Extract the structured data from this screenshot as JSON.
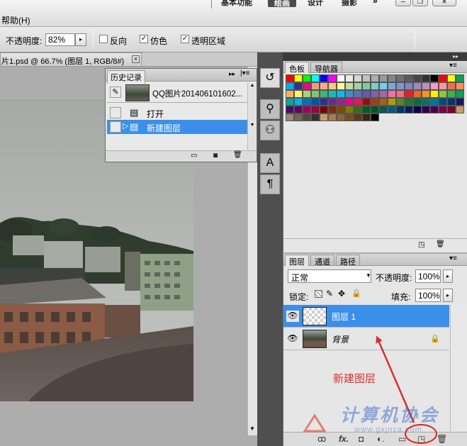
{
  "menubar": {
    "help": "帮助(H)",
    "workspaces": [
      "基本功能",
      "绘画",
      "设计",
      "摄影"
    ],
    "more": "»",
    "window_controls": [
      "minimize-icon",
      "restore-icon",
      "close-icon"
    ]
  },
  "options": {
    "opacity_label": "不透明度:",
    "opacity_value": "82%",
    "reverse": {
      "label": "反向",
      "checked": false
    },
    "dither": {
      "label": "仿色",
      "checked": true
    },
    "transparency": {
      "label": "透明区域",
      "checked": true
    }
  },
  "document": {
    "tab_title": "片1.psd @ 66.7% (图层 1, RGB/8#)",
    "close": "×"
  },
  "history": {
    "title": "历史记录",
    "snapshot": "QQ图片201406101602...",
    "steps": [
      {
        "label": "打开",
        "active": false
      },
      {
        "label": "新建图层",
        "active": true
      }
    ]
  },
  "swatches": {
    "tabs": [
      "色板",
      "导航器"
    ],
    "colors": [
      [
        "#ff0000",
        "#ffff00",
        "#00ff00",
        "#00ffff",
        "#0000ff",
        "#ff00ff",
        "#ffffff",
        "#ebebeb",
        "#d6d6d6",
        "#c2c2c2",
        "#adadad",
        "#999999",
        "#858585",
        "#707070",
        "#5c5c5c",
        "#474747",
        "#333333",
        "#000000",
        "#ff0000",
        "#ffff00",
        "#00a651"
      ],
      [
        "#00aeef",
        "#2e3192",
        "#ec008c",
        "#f7977a",
        "#f9ad81",
        "#fdc68a",
        "#fff79a",
        "#c4df9b",
        "#a3d39c",
        "#82ca9d",
        "#7bcdc8",
        "#6ecff6",
        "#7ea7d8",
        "#8493ca",
        "#8882be",
        "#a187be",
        "#bc8dbf",
        "#f49ac2",
        "#f6989d",
        "#f26c4f",
        "#f68e55"
      ],
      [
        "#fbaf5c",
        "#fff467",
        "#acd372",
        "#7cc576",
        "#3bb878",
        "#1abbb4",
        "#00bff3",
        "#438ccb",
        "#5574b9",
        "#605ca8",
        "#855fa8",
        "#a763a8",
        "#f06ea9",
        "#f26d7d",
        "#ed1c24",
        "#f26522",
        "#f7941d",
        "#fff200",
        "#8dc73f",
        "#39b54a",
        "#00a651"
      ],
      [
        "#00a99d",
        "#00aeef",
        "#0072bc",
        "#0054a6",
        "#2e3192",
        "#662d91",
        "#92278f",
        "#ec008c",
        "#ed145b",
        "#9e0b0f",
        "#a0410d",
        "#a36209",
        "#aba000",
        "#598527",
        "#1a7b30",
        "#007236",
        "#00746b",
        "#0076a3",
        "#004b80",
        "#003471",
        "#1b1464"
      ],
      [
        "#440e62",
        "#630460",
        "#9e005d",
        "#9e0039",
        "#790000",
        "#7b2e00",
        "#7d4900",
        "#827b00",
        "#406618",
        "#005e20",
        "#005826",
        "#005952",
        "#005b7f",
        "#003663",
        "#002157",
        "#0d004c",
        "#32004b",
        "#4b0049",
        "#7b0046",
        "#7a0026",
        "#c69c6d"
      ],
      [
        "#998675",
        "#736357",
        "#534741",
        "#362f2d",
        "#c69c6d",
        "#a67c52",
        "#8c6239",
        "#754c24",
        "#603913",
        "#3c2415",
        "#000000"
      ]
    ]
  },
  "layers": {
    "tabs": [
      "图层",
      "通道",
      "路径"
    ],
    "blend_mode": "正常",
    "opacity_label": "不透明度:",
    "opacity_value": "100%",
    "lock_label": "锁定:",
    "fill_label": "填充:",
    "fill_value": "100%",
    "items": [
      {
        "name": "图层 1",
        "selected": true,
        "locked": false
      },
      {
        "name": "背景",
        "selected": false,
        "locked": true
      }
    ],
    "footer_icons": [
      "link-icon",
      "fx-icon",
      "mask-icon",
      "adjustment-icon",
      "group-folder-icon",
      "new-layer-icon",
      "trash-icon"
    ],
    "footer_glyphs": [
      "ꝏ",
      "fx.",
      "◘",
      "◐.",
      "▭",
      "◳",
      "🗑"
    ]
  },
  "annotation": {
    "text": "新建图层",
    "color": "#d83030"
  },
  "watermark": {
    "text": "计算机协会",
    "url": "www.gxjnca.com"
  }
}
